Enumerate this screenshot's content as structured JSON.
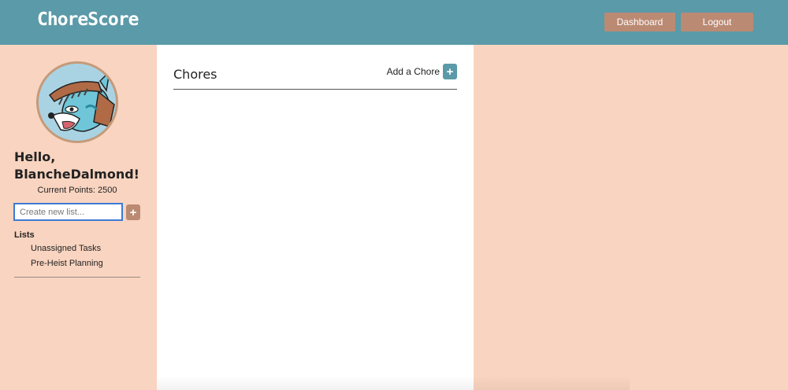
{
  "header": {
    "brand": "ChoreScore",
    "dashboard_label": "Dashboard",
    "logout_label": "Logout"
  },
  "sidebar": {
    "greeting": "Hello, BlancheDalmond!",
    "points": "Current Points: 2500",
    "new_list_placeholder": "Create new list...",
    "add_list_label": "+",
    "lists_heading": "Lists",
    "lists": [
      {
        "label": "Unassigned Tasks"
      },
      {
        "label": "Pre-Heist Planning"
      }
    ]
  },
  "main": {
    "title": "Chores",
    "add_chore_label": "Add a Chore",
    "add_chore_icon": "+"
  },
  "colors": {
    "header_bg": "#5b9aa8",
    "page_bg": "#f9d4c0",
    "button_brown": "#bb8a73",
    "accent_teal": "#5b9aa8"
  }
}
